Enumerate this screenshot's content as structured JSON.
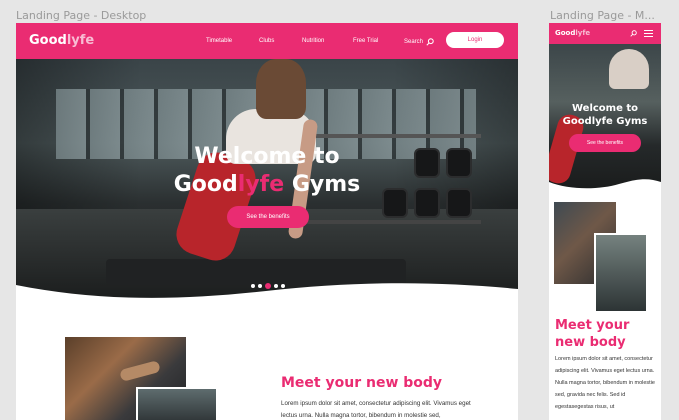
{
  "frames": {
    "desktop_label": "Landing Page - Desktop",
    "mobile_label": "Landing Page - M..."
  },
  "brand": {
    "logo_main": "Good",
    "logo_accent": "lyfe",
    "primary_color": "#ea2c72",
    "accent_light": "#f8bcd3"
  },
  "desktop": {
    "nav": {
      "items": [
        "Timetable",
        "Clubs",
        "Nutrition",
        "Free Trial"
      ],
      "search_label": "Search",
      "search_icon": "search-icon",
      "login_label": "Login"
    },
    "hero": {
      "title_line1": "Welcome to",
      "title_good": "Good",
      "title_lyfe": "lyfe",
      "title_gyms": " Gyms",
      "cta_label": "See the benefits",
      "slides": 5,
      "active_slide": 3
    },
    "section": {
      "title": "Meet your new body",
      "body": "Lorem ipsum dolor sit amet, consectetur adipiscing elit. Vivamus eget lectus urna. Nulla magna tortor, bibendum in molestie sed,"
    }
  },
  "mobile": {
    "search_icon": "search-icon",
    "menu_icon": "hamburger-menu-icon",
    "hero": {
      "title_line1": "Welcome to",
      "title_line2": "Goodlyfe Gyms",
      "cta_label": "See the benefits",
      "slides": 5,
      "active_slide": 3
    },
    "section": {
      "title": "Meet your new body",
      "body": "Lorem ipsum dolor sit amet, consectetur adipiscing elit. Vivamus eget lectus urna. Nulla magna tortor, bibendum in molestie sed, gravida nec felis. Sed id egestasegestas risus, ut"
    }
  }
}
